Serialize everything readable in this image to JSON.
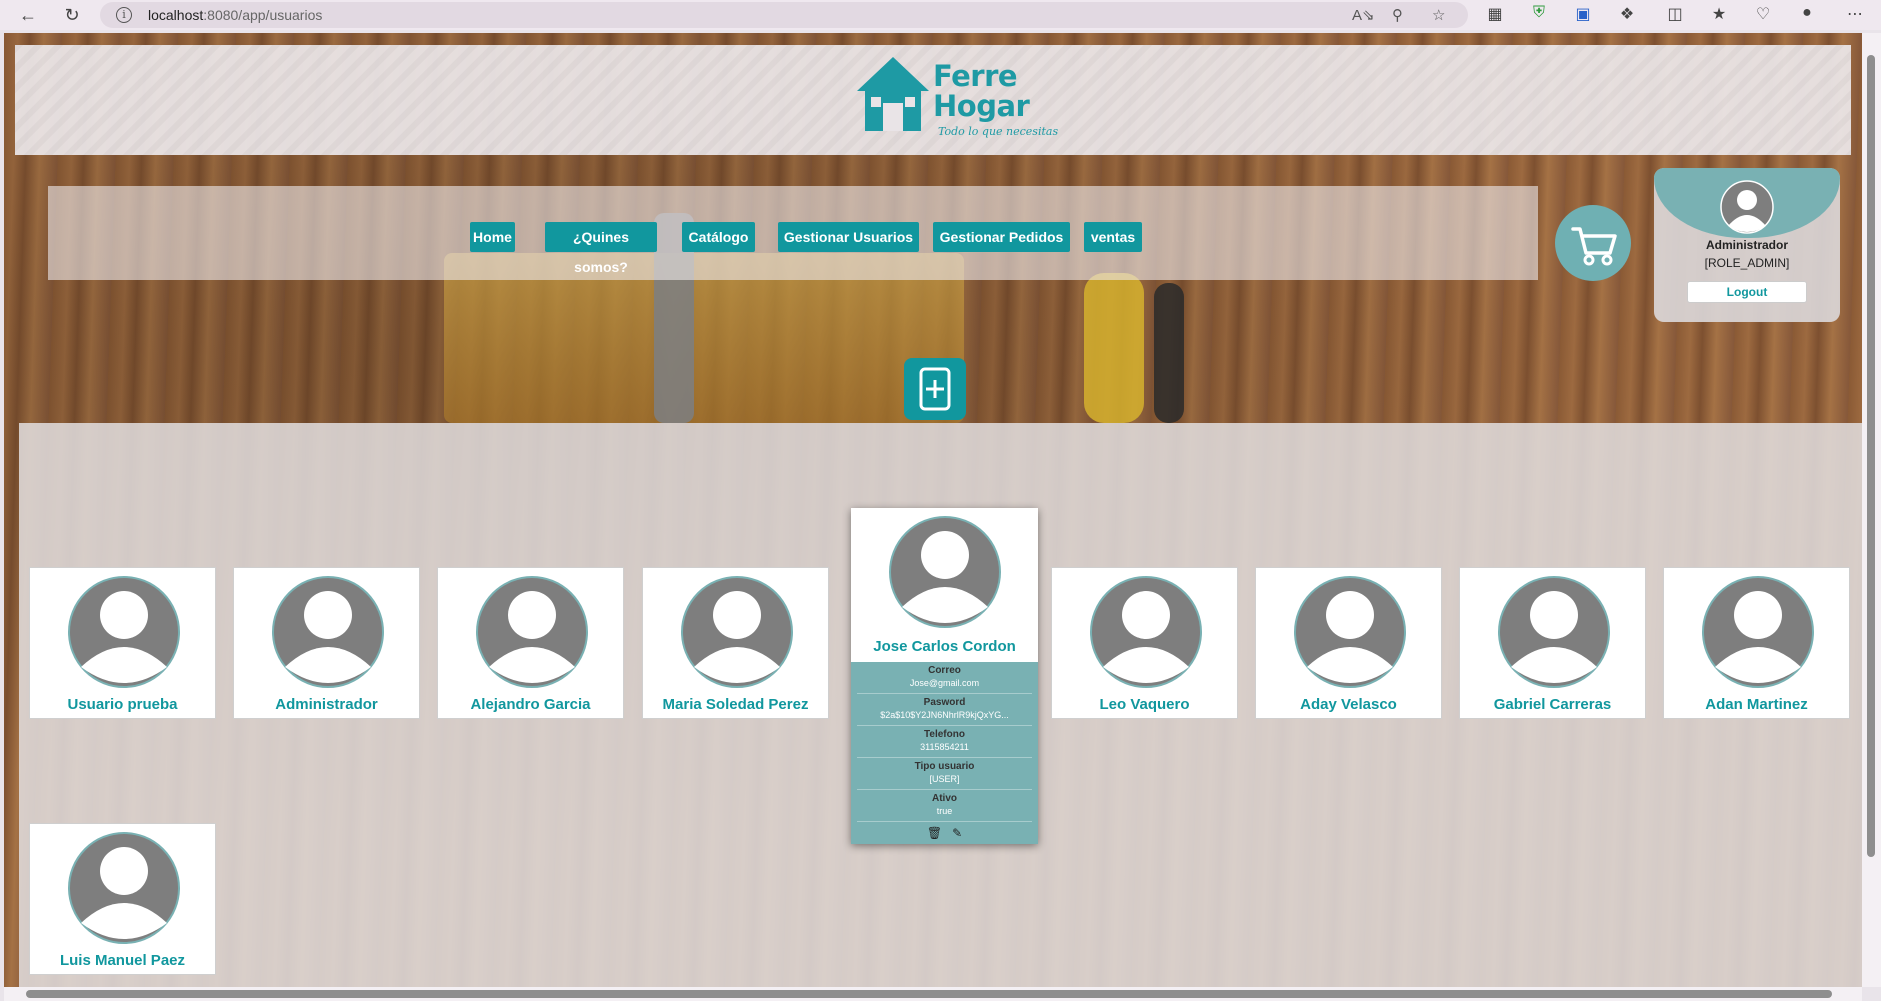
{
  "browser": {
    "url_host": "localhost",
    "url_rest": ":8080/app/usuarios"
  },
  "brand": {
    "line1": "Ferre",
    "line2": "Hogar",
    "tagline": "Todo lo que necesitas"
  },
  "nav": {
    "items": [
      {
        "label": "Home"
      },
      {
        "label": "¿Quines somos?"
      },
      {
        "label": "Catálogo"
      },
      {
        "label": "Gestionar Usuarios"
      },
      {
        "label": "Gestionar Pedidos"
      },
      {
        "label": "ventas"
      }
    ]
  },
  "current_user": {
    "name": "Administrador",
    "role": "[ROLE_ADMIN]",
    "logout_label": "Logout"
  },
  "users": [
    {
      "name": "Usuario prueba"
    },
    {
      "name": "Administrador"
    },
    {
      "name": "Alejandro Garcia"
    },
    {
      "name": "Maria Soledad Perez"
    },
    {
      "name": "Leo Vaquero"
    },
    {
      "name": "Aday Velasco"
    },
    {
      "name": "Gabriel Carreras"
    },
    {
      "name": "Adan Martinez"
    },
    {
      "name": "Luis Manuel Paez"
    }
  ],
  "selected_user": {
    "name": "Jose Carlos Cordon",
    "fields": [
      {
        "label": "Correo",
        "value": "Jose@gmail.com"
      },
      {
        "label": "Pasword",
        "value": "$2a$10$Y2JN6NhrlR9kjQxYG..."
      },
      {
        "label": "Telefono",
        "value": "3115854211"
      },
      {
        "label": "Tipo usuario",
        "value": "[USER]"
      },
      {
        "label": "Ativo",
        "value": "true"
      }
    ]
  },
  "colors": {
    "accent": "#11979e",
    "panel_teal": "#79b1b3"
  }
}
